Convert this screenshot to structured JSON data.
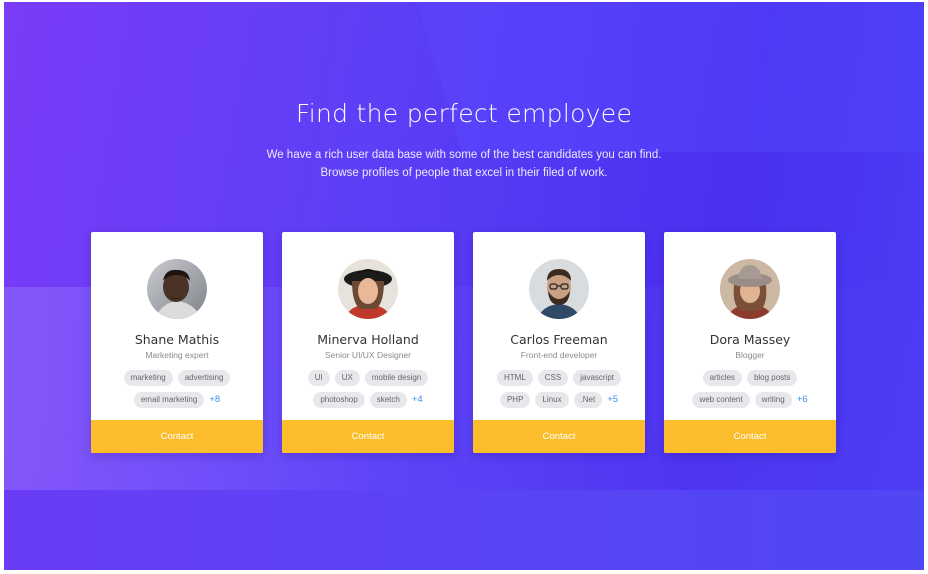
{
  "hero": {
    "title": "Find the perfect employee",
    "line1": "We have a rich user data base with some of the best candidates you can find.",
    "line2": "Browse profiles of people that excel in their filed of work."
  },
  "cards": [
    {
      "name": "Shane Mathis",
      "role": "Marketing expert",
      "tags": [
        "marketing",
        "advertising",
        "email marketing"
      ],
      "more": "+8",
      "contact": "Contact"
    },
    {
      "name": "Minerva Holland",
      "role": "Senior UI/UX Designer",
      "tags": [
        "UI",
        "UX",
        "mobile design",
        "photoshop",
        "sketch"
      ],
      "more": "+4",
      "contact": "Contact"
    },
    {
      "name": "Carlos Freeman",
      "role": "Front-end developer",
      "tags": [
        "HTML",
        "CSS",
        "javascript",
        "PHP",
        "Linux",
        ".Net"
      ],
      "more": "+5",
      "contact": "Contact"
    },
    {
      "name": "Dora Massey",
      "role": "Blogger",
      "tags": [
        "articles",
        "blog posts",
        "web content",
        "writing"
      ],
      "more": "+6",
      "contact": "Contact"
    }
  ],
  "colors": {
    "accent": "#fbbd2b",
    "more_link": "#3d8df0",
    "background_start": "#7a3cf7",
    "background_end": "#4b3df5"
  }
}
